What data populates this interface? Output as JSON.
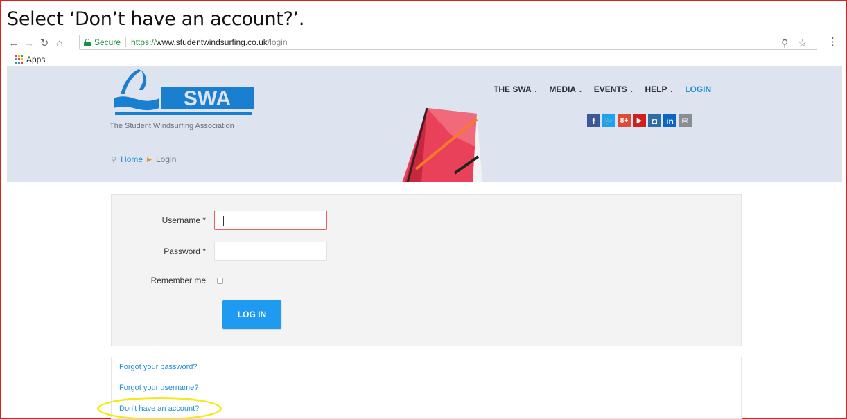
{
  "instruction": "Select ‘Don’t have an account?’.",
  "browser": {
    "secure_label": "Secure",
    "url_scheme": "https://",
    "url_host": "www.studentwindsurfing.co.uk",
    "url_path": "/login",
    "bookmarks": [
      "Apps"
    ]
  },
  "site": {
    "logo_text": "SWA",
    "tagline": "The Student Windsurfing Association",
    "nav": [
      "THE SWA",
      "MEDIA",
      "EVENTS",
      "HELP",
      "LOGIN"
    ],
    "social": [
      "f",
      "t",
      "8+",
      "yt",
      "ig",
      "in",
      "mail"
    ],
    "breadcrumb": {
      "home": "Home",
      "current": "Login"
    },
    "colors": {
      "accent": "#1e8fd8",
      "header_bg": "#dde3ef",
      "button": "#1e9af0"
    }
  },
  "form": {
    "username_label": "Username *",
    "password_label": "Password *",
    "remember_label": "Remember me",
    "login_button": "LOG IN"
  },
  "links": {
    "forgot_password": "Forgot your password?",
    "forgot_username": "Forgot your username?",
    "register": "Don't have an account?"
  }
}
